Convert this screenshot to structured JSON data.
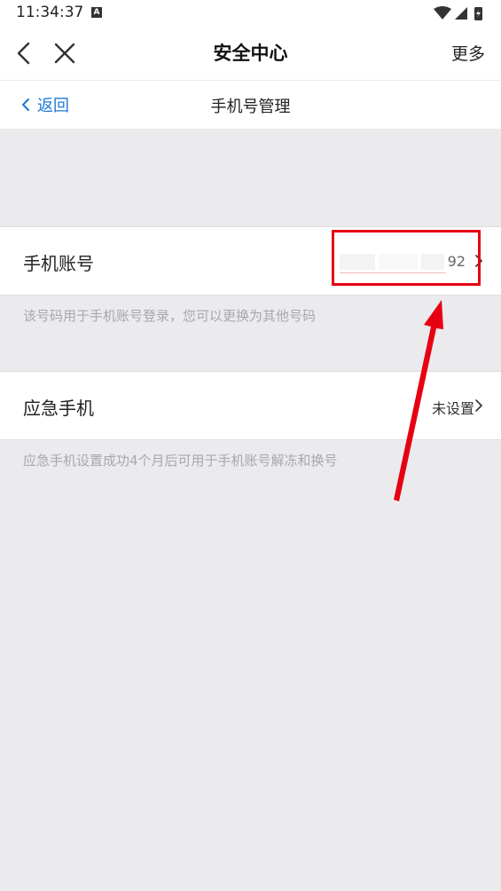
{
  "status_bar": {
    "time": "11:34:37",
    "notification_letter": "A"
  },
  "header": {
    "title": "安全中心",
    "more_label": "更多"
  },
  "subnav": {
    "back_label": "返回",
    "title": "手机号管理"
  },
  "phone_account": {
    "label": "手机账号",
    "value_visible_suffix": "92",
    "hint": "该号码用于手机账号登录，您可以更换为其他号码"
  },
  "emergency_phone": {
    "label": "应急手机",
    "value": "未设置",
    "hint": "应急手机设置成功4个月后可用于手机账号解冻和换号"
  },
  "colors": {
    "accent_blue": "#1b78d6",
    "annotation_red": "#e60012",
    "background": "#ebebed"
  }
}
